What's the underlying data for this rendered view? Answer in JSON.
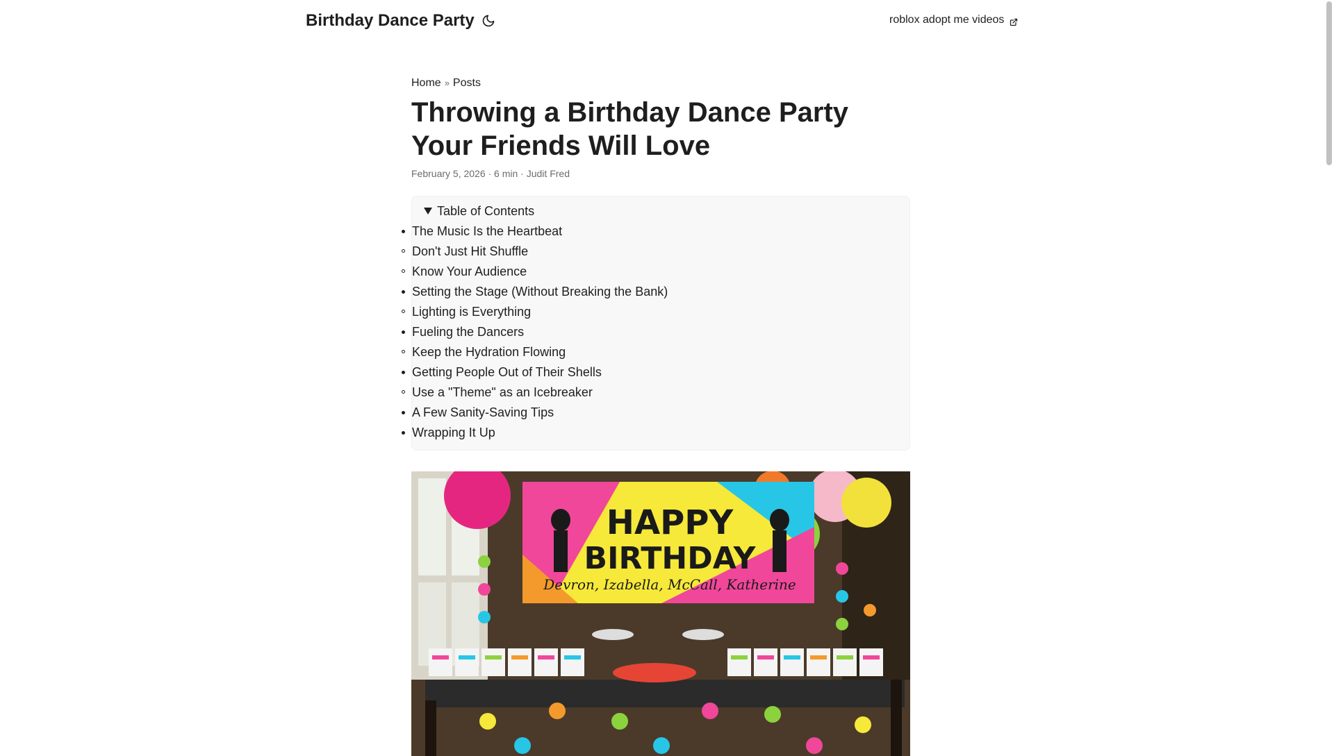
{
  "header": {
    "logo": "Birthday Dance Party",
    "theme_toggle_icon": "moon-icon",
    "menu_link": "roblox adopt me videos",
    "menu_link_icon": "external-link-icon"
  },
  "breadcrumbs": {
    "home": "Home",
    "separator": "»",
    "posts": "Posts"
  },
  "post": {
    "title": "Throwing a Birthday Dance Party Your Friends Will Love",
    "meta": "February 5, 2026 · 6 min · Judit Fred"
  },
  "toc": {
    "summary": "Table of Contents",
    "items": [
      {
        "label": "The Music Is the Heartbeat",
        "children": [
          "Don't Just Hit Shuffle",
          "Know Your Audience"
        ]
      },
      {
        "label": "Setting the Stage (Without Breaking the Bank)",
        "children": [
          "Lighting is Everything"
        ]
      },
      {
        "label": "Fueling the Dancers",
        "children": [
          "Keep the Hydration Flowing"
        ]
      },
      {
        "label": "Getting People Out of Their Shells",
        "children": [
          "Use a \"Theme\" as an Icebreaker"
        ]
      },
      {
        "label": "A Few Sanity-Saving Tips",
        "children": []
      },
      {
        "label": "Wrapping It Up",
        "children": []
      }
    ]
  },
  "cover": {
    "banner_line1": "HAPPY",
    "banner_line2": "BIRTHDAY",
    "banner_names": "Devron, Izabella, McCall, Katherine",
    "colors": {
      "banner_pink": "#f0479a",
      "banner_yellow": "#f6e93a",
      "banner_cyan": "#27c6e6",
      "table_cloth": "#2b2b2b",
      "floor": "#3a2a1c"
    }
  }
}
